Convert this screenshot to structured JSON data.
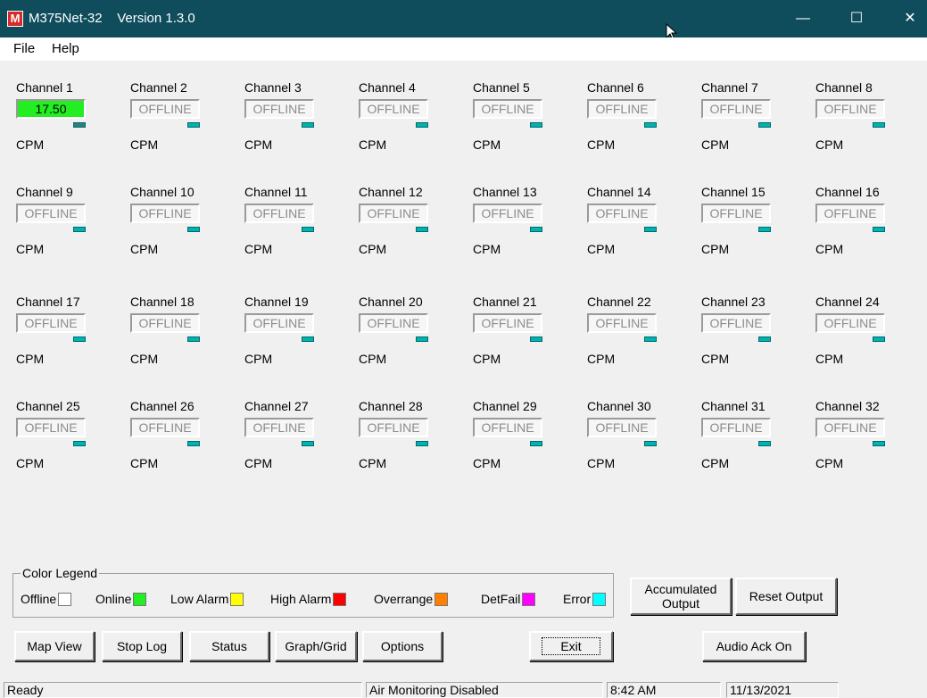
{
  "window": {
    "title": "M375Net-32    Version 1.3.0",
    "app_icon_letter": "M",
    "controls": {
      "minimize": "—",
      "maximize": "☐",
      "close": "✕"
    }
  },
  "menu": {
    "file": "File",
    "help": "Help"
  },
  "unit_label": "CPM",
  "channels": [
    {
      "label": "Channel 1",
      "value": "17.50",
      "state": "online"
    },
    {
      "label": "Channel 2",
      "value": "OFFLINE",
      "state": "offline"
    },
    {
      "label": "Channel 3",
      "value": "OFFLINE",
      "state": "offline"
    },
    {
      "label": "Channel 4",
      "value": "OFFLINE",
      "state": "offline"
    },
    {
      "label": "Channel 5",
      "value": "OFFLINE",
      "state": "offline"
    },
    {
      "label": "Channel 6",
      "value": "OFFLINE",
      "state": "offline"
    },
    {
      "label": "Channel 7",
      "value": "OFFLINE",
      "state": "offline"
    },
    {
      "label": "Channel 8",
      "value": "OFFLINE",
      "state": "offline"
    },
    {
      "label": "Channel 9",
      "value": "OFFLINE",
      "state": "offline"
    },
    {
      "label": "Channel 10",
      "value": "OFFLINE",
      "state": "offline"
    },
    {
      "label": "Channel 11",
      "value": "OFFLINE",
      "state": "offline"
    },
    {
      "label": "Channel 12",
      "value": "OFFLINE",
      "state": "offline"
    },
    {
      "label": "Channel 13",
      "value": "OFFLINE",
      "state": "offline"
    },
    {
      "label": "Channel 14",
      "value": "OFFLINE",
      "state": "offline"
    },
    {
      "label": "Channel 15",
      "value": "OFFLINE",
      "state": "offline"
    },
    {
      "label": "Channel 16",
      "value": "OFFLINE",
      "state": "offline"
    },
    {
      "label": "Channel 17",
      "value": "OFFLINE",
      "state": "offline"
    },
    {
      "label": "Channel 18",
      "value": "OFFLINE",
      "state": "offline"
    },
    {
      "label": "Channel 19",
      "value": "OFFLINE",
      "state": "offline"
    },
    {
      "label": "Channel 20",
      "value": "OFFLINE",
      "state": "offline"
    },
    {
      "label": "Channel 21",
      "value": "OFFLINE",
      "state": "offline"
    },
    {
      "label": "Channel 22",
      "value": "OFFLINE",
      "state": "offline"
    },
    {
      "label": "Channel 23",
      "value": "OFFLINE",
      "state": "offline"
    },
    {
      "label": "Channel 24",
      "value": "OFFLINE",
      "state": "offline"
    },
    {
      "label": "Channel 25",
      "value": "OFFLINE",
      "state": "offline"
    },
    {
      "label": "Channel 26",
      "value": "OFFLINE",
      "state": "offline"
    },
    {
      "label": "Channel 27",
      "value": "OFFLINE",
      "state": "offline"
    },
    {
      "label": "Channel 28",
      "value": "OFFLINE",
      "state": "offline"
    },
    {
      "label": "Channel 29",
      "value": "OFFLINE",
      "state": "offline"
    },
    {
      "label": "Channel 30",
      "value": "OFFLINE",
      "state": "offline"
    },
    {
      "label": "Channel 31",
      "value": "OFFLINE",
      "state": "offline"
    },
    {
      "label": "Channel 32",
      "value": "OFFLINE",
      "state": "offline"
    }
  ],
  "legend": {
    "title": "Color Legend",
    "items": [
      {
        "label": "Offline",
        "color": "#ffffff"
      },
      {
        "label": "Online",
        "color": "#22ee22"
      },
      {
        "label": "Low Alarm",
        "color": "#ffff00"
      },
      {
        "label": "High Alarm",
        "color": "#ff0000"
      },
      {
        "label": "Overrange",
        "color": "#ff8000"
      },
      {
        "label": "DetFail",
        "color": "#ff00ff"
      },
      {
        "label": "Error",
        "color": "#00ffff"
      }
    ]
  },
  "buttons": {
    "accumulated_output": "Accumulated Output",
    "reset_output": "Reset Output",
    "map_view": "Map View",
    "stop_log": "Stop Log",
    "status": "Status",
    "graph_grid": "Graph/Grid",
    "options": "Options",
    "exit": "Exit",
    "audio_ack": "Audio Ack On"
  },
  "status_bar": {
    "state": "Ready",
    "monitoring": "Air Monitoring Disabled",
    "time": "8:42 AM",
    "date": "11/13/2021"
  }
}
